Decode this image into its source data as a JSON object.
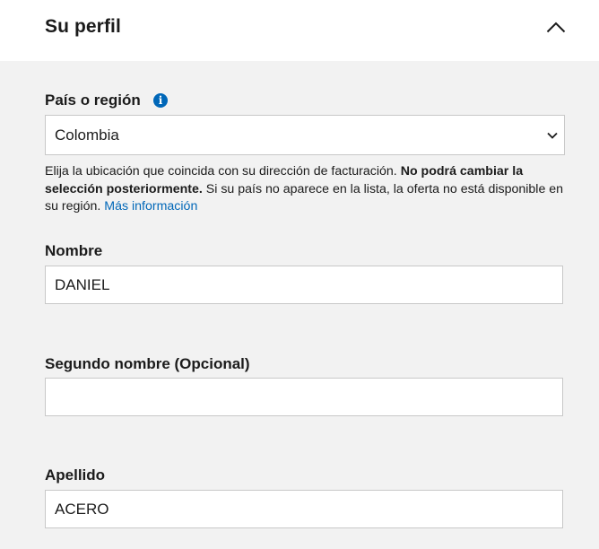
{
  "header": {
    "title": "Su perfil",
    "collapse_icon": "chevron-up-icon"
  },
  "country": {
    "label": "País o región",
    "info_icon": "info-icon",
    "selected": "Colombia",
    "help_text_1": "Elija la ubicación que coincida con su dirección de facturación. ",
    "help_text_bold": "No podrá cambiar la selección posteriormente.",
    "help_text_2": " Si su país no aparece en la lista, la oferta no está disponible en su región. ",
    "help_link": "Más información",
    "link_color": "#0067b8"
  },
  "first_name": {
    "label": "Nombre",
    "value": "DANIEL"
  },
  "middle_name": {
    "label": "Segundo nombre (Opcional)",
    "value": ""
  },
  "last_name": {
    "label": "Apellido",
    "value": "ACERO"
  }
}
